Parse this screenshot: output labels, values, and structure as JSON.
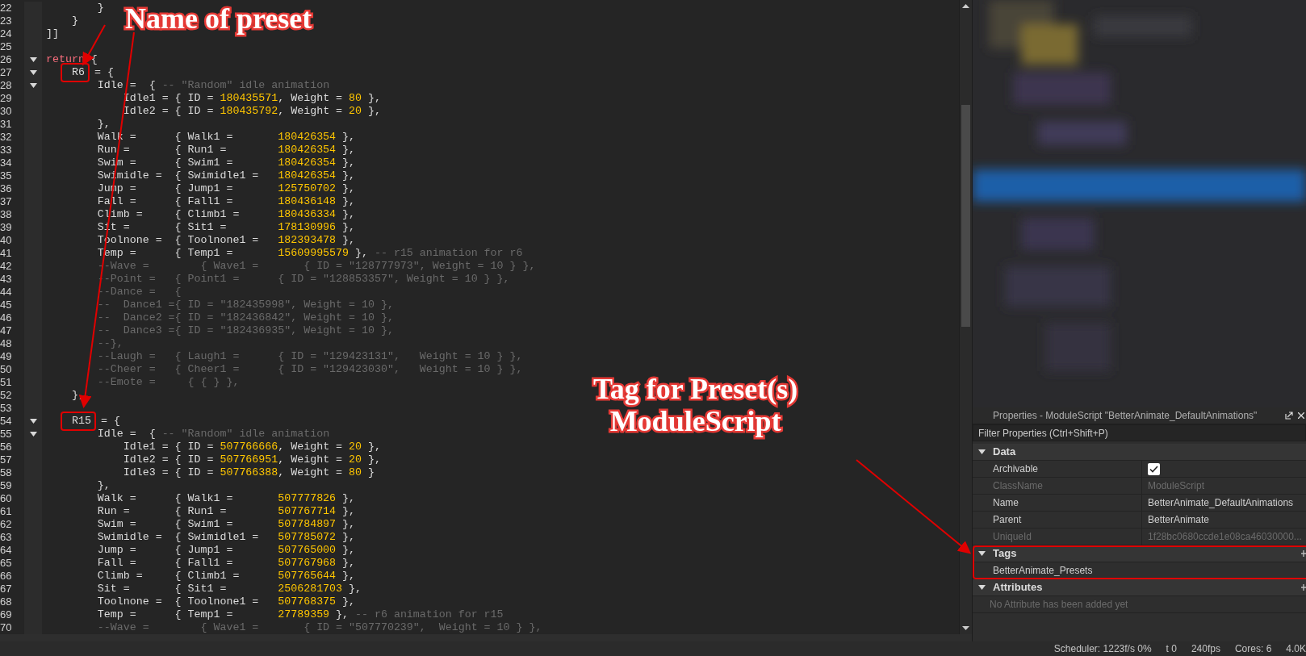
{
  "annotations": {
    "preset_label": "Name of preset",
    "tag_label": [
      "Tag for Preset(s)",
      "ModuleScript"
    ]
  },
  "editor": {
    "lines": [
      {
        "n": "22",
        "fold": false,
        "tokens": [
          {
            "kind": "plain",
            "text": "        }"
          }
        ]
      },
      {
        "n": "23",
        "fold": false,
        "tokens": [
          {
            "kind": "plain",
            "text": "    }"
          }
        ]
      },
      {
        "n": "24",
        "fold": false,
        "tokens": [
          {
            "kind": "plain",
            "text": "]]"
          }
        ]
      },
      {
        "n": "25",
        "fold": false
      },
      {
        "n": "26",
        "fold": true,
        "tokens": [
          {
            "kind": "keyword",
            "text": "return"
          },
          {
            "kind": "plain",
            "text": " {"
          }
        ]
      },
      {
        "n": "27",
        "fold": true,
        "tokens": [
          {
            "kind": "marked",
            "text": "R6"
          },
          {
            "kind": "plain",
            "text": " = {"
          }
        ]
      },
      {
        "n": "28",
        "fold": true,
        "tokens": [
          {
            "kind": "plain",
            "text": "        Idle =  { "
          },
          {
            "kind": "comment",
            "text": "-- \"Random\" idle animation"
          }
        ]
      },
      {
        "n": "29",
        "fold": false,
        "tokens": [
          {
            "kind": "plain",
            "text": "            Idle1 = { ID = "
          },
          {
            "kind": "number",
            "text": "180435571"
          },
          {
            "kind": "plain",
            "text": ", Weight = "
          },
          {
            "kind": "number",
            "text": "80"
          },
          {
            "kind": "plain",
            "text": " },"
          }
        ]
      },
      {
        "n": "30",
        "fold": false,
        "tokens": [
          {
            "kind": "plain",
            "text": "            Idle2 = { ID = "
          },
          {
            "kind": "number",
            "text": "180435792"
          },
          {
            "kind": "plain",
            "text": ", Weight = "
          },
          {
            "kind": "number",
            "text": "20"
          },
          {
            "kind": "plain",
            "text": " },"
          }
        ]
      },
      {
        "n": "31",
        "fold": false,
        "tokens": [
          {
            "kind": "plain",
            "text": "        },"
          }
        ]
      },
      {
        "n": "32",
        "fold": false,
        "tokens": [
          {
            "kind": "plain",
            "text": "        Walk =      { Walk1 =       "
          },
          {
            "kind": "number",
            "text": "180426354"
          },
          {
            "kind": "plain",
            "text": " },"
          }
        ]
      },
      {
        "n": "33",
        "fold": false,
        "tokens": [
          {
            "kind": "plain",
            "text": "        Run =       { Run1 =        "
          },
          {
            "kind": "number",
            "text": "180426354"
          },
          {
            "kind": "plain",
            "text": " },"
          }
        ]
      },
      {
        "n": "34",
        "fold": false,
        "tokens": [
          {
            "kind": "plain",
            "text": "        Swim =      { Swim1 =       "
          },
          {
            "kind": "number",
            "text": "180426354"
          },
          {
            "kind": "plain",
            "text": " },"
          }
        ]
      },
      {
        "n": "35",
        "fold": false,
        "tokens": [
          {
            "kind": "plain",
            "text": "        Swimidle =  { Swimidle1 =   "
          },
          {
            "kind": "number",
            "text": "180426354"
          },
          {
            "kind": "plain",
            "text": " },"
          }
        ]
      },
      {
        "n": "36",
        "fold": false,
        "tokens": [
          {
            "kind": "plain",
            "text": "        Jump =      { Jump1 =       "
          },
          {
            "kind": "number",
            "text": "125750702"
          },
          {
            "kind": "plain",
            "text": " },"
          }
        ]
      },
      {
        "n": "37",
        "fold": false,
        "tokens": [
          {
            "kind": "plain",
            "text": "        Fall =      { Fall1 =       "
          },
          {
            "kind": "number",
            "text": "180436148"
          },
          {
            "kind": "plain",
            "text": " },"
          }
        ]
      },
      {
        "n": "38",
        "fold": false,
        "tokens": [
          {
            "kind": "plain",
            "text": "        Climb =     { Climb1 =      "
          },
          {
            "kind": "number",
            "text": "180436334"
          },
          {
            "kind": "plain",
            "text": " },"
          }
        ]
      },
      {
        "n": "39",
        "fold": false,
        "tokens": [
          {
            "kind": "plain",
            "text": "        Sit =       { Sit1 =        "
          },
          {
            "kind": "number",
            "text": "178130996"
          },
          {
            "kind": "plain",
            "text": " },"
          }
        ]
      },
      {
        "n": "40",
        "fold": false,
        "tokens": [
          {
            "kind": "plain",
            "text": "        Toolnone =  { Toolnone1 =   "
          },
          {
            "kind": "number",
            "text": "182393478"
          },
          {
            "kind": "plain",
            "text": " },"
          }
        ]
      },
      {
        "n": "41",
        "fold": false,
        "tokens": [
          {
            "kind": "plain",
            "text": "        Temp =      { Temp1 =       "
          },
          {
            "kind": "number",
            "text": "15609995579"
          },
          {
            "kind": "plain",
            "text": " }, "
          },
          {
            "kind": "comment",
            "text": "-- r15 animation for r6"
          }
        ]
      },
      {
        "n": "42",
        "fold": false,
        "tokens": [
          {
            "kind": "comment",
            "text": "        --Wave =        { Wave1 =       { ID = \"128777973\", Weight = 10 } },"
          }
        ]
      },
      {
        "n": "43",
        "fold": false,
        "tokens": [
          {
            "kind": "comment",
            "text": "        --Point =   { Point1 =      { ID = \"128853357\", Weight = 10 } },"
          }
        ]
      },
      {
        "n": "44",
        "fold": false,
        "tokens": [
          {
            "kind": "comment",
            "text": "        --Dance =   {"
          }
        ]
      },
      {
        "n": "45",
        "fold": false,
        "tokens": [
          {
            "kind": "comment",
            "text": "        --  Dance1 ={ ID = \"182435998\", Weight = 10 },"
          }
        ]
      },
      {
        "n": "46",
        "fold": false,
        "tokens": [
          {
            "kind": "comment",
            "text": "        --  Dance2 ={ ID = \"182436842\", Weight = 10 },"
          }
        ]
      },
      {
        "n": "47",
        "fold": false,
        "tokens": [
          {
            "kind": "comment",
            "text": "        --  Dance3 ={ ID = \"182436935\", Weight = 10 },"
          }
        ]
      },
      {
        "n": "48",
        "fold": false,
        "tokens": [
          {
            "kind": "comment",
            "text": "        --},"
          }
        ]
      },
      {
        "n": "49",
        "fold": false,
        "tokens": [
          {
            "kind": "comment",
            "text": "        --Laugh =   { Laugh1 =      { ID = \"129423131\",   Weight = 10 } },"
          }
        ]
      },
      {
        "n": "50",
        "fold": false,
        "tokens": [
          {
            "kind": "comment",
            "text": "        --Cheer =   { Cheer1 =      { ID = \"129423030\",   Weight = 10 } },"
          }
        ]
      },
      {
        "n": "51",
        "fold": false,
        "tokens": [
          {
            "kind": "comment",
            "text": "        --Emote =     { { } },"
          }
        ]
      },
      {
        "n": "52",
        "fold": false,
        "tokens": [
          {
            "kind": "plain",
            "text": "    },"
          }
        ]
      },
      {
        "n": "53",
        "fold": false
      },
      {
        "n": "54",
        "fold": true,
        "tokens": [
          {
            "kind": "marked",
            "text": "R15"
          },
          {
            "kind": "plain",
            "text": " = {"
          }
        ]
      },
      {
        "n": "55",
        "fold": true,
        "tokens": [
          {
            "kind": "plain",
            "text": "        Idle =  { "
          },
          {
            "kind": "comment",
            "text": "-- \"Random\" idle animation"
          }
        ]
      },
      {
        "n": "56",
        "fold": false,
        "tokens": [
          {
            "kind": "plain",
            "text": "            Idle1 = { ID = "
          },
          {
            "kind": "number",
            "text": "507766666"
          },
          {
            "kind": "plain",
            "text": ", Weight = "
          },
          {
            "kind": "number",
            "text": "20"
          },
          {
            "kind": "plain",
            "text": " },"
          }
        ]
      },
      {
        "n": "57",
        "fold": false,
        "tokens": [
          {
            "kind": "plain",
            "text": "            Idle2 = { ID = "
          },
          {
            "kind": "number",
            "text": "507766951"
          },
          {
            "kind": "plain",
            "text": ", Weight = "
          },
          {
            "kind": "number",
            "text": "20"
          },
          {
            "kind": "plain",
            "text": " },"
          }
        ]
      },
      {
        "n": "58",
        "fold": false,
        "tokens": [
          {
            "kind": "plain",
            "text": "            Idle3 = { ID = "
          },
          {
            "kind": "number",
            "text": "507766388"
          },
          {
            "kind": "plain",
            "text": ", Weight = "
          },
          {
            "kind": "number",
            "text": "80"
          },
          {
            "kind": "plain",
            "text": " }"
          }
        ]
      },
      {
        "n": "59",
        "fold": false,
        "tokens": [
          {
            "kind": "plain",
            "text": "        },"
          }
        ]
      },
      {
        "n": "60",
        "fold": false,
        "tokens": [
          {
            "kind": "plain",
            "text": "        Walk =      { Walk1 =       "
          },
          {
            "kind": "number",
            "text": "507777826"
          },
          {
            "kind": "plain",
            "text": " },"
          }
        ]
      },
      {
        "n": "61",
        "fold": false,
        "tokens": [
          {
            "kind": "plain",
            "text": "        Run =       { Run1 =        "
          },
          {
            "kind": "number",
            "text": "507767714"
          },
          {
            "kind": "plain",
            "text": " },"
          }
        ]
      },
      {
        "n": "62",
        "fold": false,
        "tokens": [
          {
            "kind": "plain",
            "text": "        Swim =      { Swim1 =       "
          },
          {
            "kind": "number",
            "text": "507784897"
          },
          {
            "kind": "plain",
            "text": " },"
          }
        ]
      },
      {
        "n": "63",
        "fold": false,
        "tokens": [
          {
            "kind": "plain",
            "text": "        Swimidle =  { Swimidle1 =   "
          },
          {
            "kind": "number",
            "text": "507785072"
          },
          {
            "kind": "plain",
            "text": " },"
          }
        ]
      },
      {
        "n": "64",
        "fold": false,
        "tokens": [
          {
            "kind": "plain",
            "text": "        Jump =      { Jump1 =       "
          },
          {
            "kind": "number",
            "text": "507765000"
          },
          {
            "kind": "plain",
            "text": " },"
          }
        ]
      },
      {
        "n": "65",
        "fold": false,
        "tokens": [
          {
            "kind": "plain",
            "text": "        Fall =      { Fall1 =       "
          },
          {
            "kind": "number",
            "text": "507767968"
          },
          {
            "kind": "plain",
            "text": " },"
          }
        ]
      },
      {
        "n": "66",
        "fold": false,
        "tokens": [
          {
            "kind": "plain",
            "text": "        Climb =     { Climb1 =      "
          },
          {
            "kind": "number",
            "text": "507765644"
          },
          {
            "kind": "plain",
            "text": " },"
          }
        ]
      },
      {
        "n": "67",
        "fold": false,
        "tokens": [
          {
            "kind": "plain",
            "text": "        Sit =       { Sit1 =        "
          },
          {
            "kind": "number",
            "text": "2506281703"
          },
          {
            "kind": "plain",
            "text": " },"
          }
        ]
      },
      {
        "n": "68",
        "fold": false,
        "tokens": [
          {
            "kind": "plain",
            "text": "        Toolnone =  { Toolnone1 =   "
          },
          {
            "kind": "number",
            "text": "507768375"
          },
          {
            "kind": "plain",
            "text": " },"
          }
        ]
      },
      {
        "n": "69",
        "fold": false,
        "tokens": [
          {
            "kind": "plain",
            "text": "        Temp =      { Temp1 =       "
          },
          {
            "kind": "number",
            "text": "27789359"
          },
          {
            "kind": "plain",
            "text": " }, "
          },
          {
            "kind": "comment",
            "text": "-- r6 animation for r15"
          }
        ]
      },
      {
        "n": "70",
        "fold": false,
        "tokens": [
          {
            "kind": "comment",
            "text": "        --Wave =        { Wave1 =       { ID = \"507770239\",  Weight = 10 } },"
          }
        ]
      }
    ]
  },
  "properties": {
    "title": "Properties - ModuleScript \"BetterAnimate_DefaultAnimations\"",
    "filter": {
      "placeholder": "Filter Properties (Ctrl+Shift+P)"
    },
    "sections": [
      {
        "title": "Data",
        "expanded": true,
        "highlighted": false,
        "rows": [
          {
            "kind": "checkbox",
            "label": "Archivable",
            "checked": true,
            "disabled": false
          },
          {
            "kind": "text",
            "label": "ClassName",
            "value": "ModuleScript",
            "disabled": true
          },
          {
            "kind": "text",
            "label": "Name",
            "value": "BetterAnimate_DefaultAnimations",
            "disabled": false
          },
          {
            "kind": "text",
            "label": "Parent",
            "value": "BetterAnimate",
            "disabled": false
          },
          {
            "kind": "text",
            "label": "UniqueId",
            "value": "1f28bc0680ccde1e08ca46030000...",
            "disabled": true
          }
        ]
      },
      {
        "title": "Tags",
        "expanded": true,
        "highlighted": true,
        "rows": [
          {
            "kind": "tag",
            "label": "BetterAnimate_Presets",
            "disabled": false
          }
        ]
      },
      {
        "title": "Attributes",
        "expanded": true,
        "highlighted": false,
        "rows": [
          {
            "kind": "note",
            "label": "No Attribute has been added yet",
            "disabled": true
          }
        ]
      }
    ]
  },
  "status_bar": [
    "Scheduler: 1223f/s 0%",
    "t 0",
    "240fps",
    "Cores: 6",
    "4.0K"
  ]
}
